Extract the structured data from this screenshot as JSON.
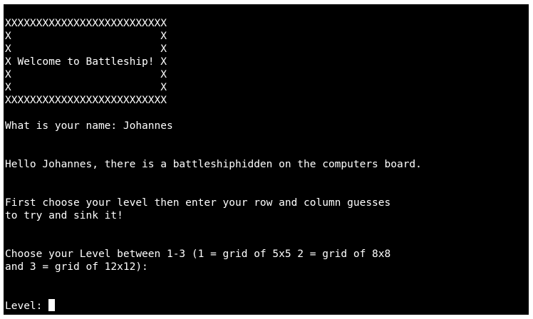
{
  "terminal": {
    "lines": [
      "XXXXXXXXXXXXXXXXXXXXXXXXXX",
      "X                        X",
      "X                        X",
      "X Welcome to Battleship! X",
      "X                        X",
      "X                        X",
      "XXXXXXXXXXXXXXXXXXXXXXXXXX",
      "",
      "What is your name: Johannes",
      "",
      "",
      "Hello Johannes, there is a battleshiphidden on the computers board.",
      "",
      "",
      "First choose your level then enter your row and column guesses",
      "to try and sink it!",
      "",
      "",
      "Choose your Level between 1-3 (1 = grid of 5x5 2 = grid of 8x8",
      "and 3 = grid of 12x12):",
      "",
      "",
      "Level: "
    ]
  }
}
